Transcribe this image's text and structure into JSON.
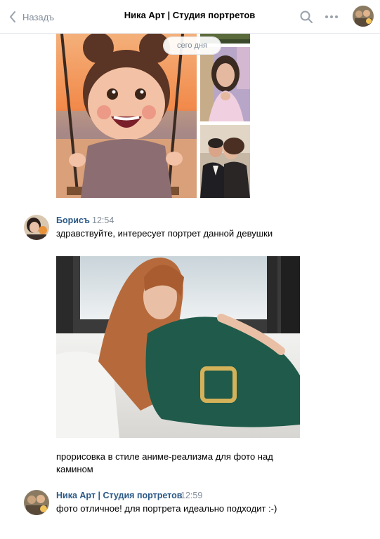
{
  "header": {
    "back_label": "Назадъ",
    "title": "Ника Арт | Студия портретов"
  },
  "date_separator": "сего дня",
  "messages": [
    {
      "author": "Борисъ",
      "time": "12:54",
      "text": "здравствуйте, интересует портрет данной девушки"
    },
    {
      "text": "прорисовка в стиле аниме-реализма для фото над камином"
    },
    {
      "author": "Ника Арт | Студия портретов",
      "time": "12:59",
      "text": "фото отличное! для портрета идеально подходит :-)"
    }
  ],
  "colors": {
    "link": "#2a5885",
    "secondary": "#818c99",
    "divider": "#e7e8ec"
  }
}
